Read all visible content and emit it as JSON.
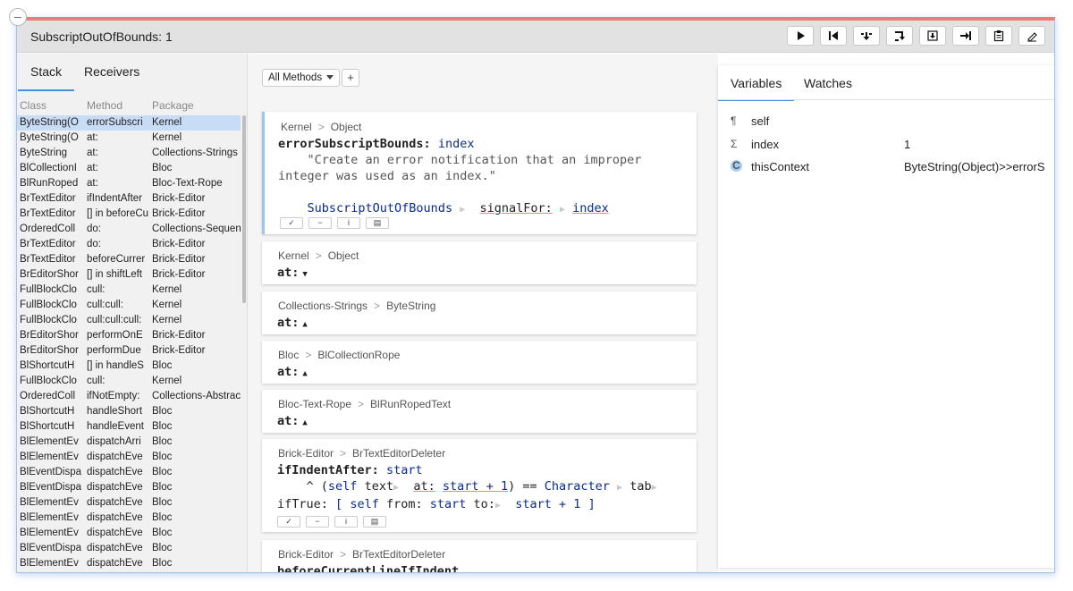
{
  "window": {
    "title": "SubscriptOutOfBounds: 1"
  },
  "toolbar": {
    "buttons": [
      "play-icon",
      "restart-icon",
      "step-into-icon",
      "step-over-icon",
      "step-through-icon",
      "run-to-icon",
      "copy-icon",
      "edit-icon"
    ]
  },
  "stack": {
    "tabs": [
      "Stack",
      "Receivers"
    ],
    "columns": [
      "Class",
      "Method",
      "Package"
    ],
    "rows": [
      [
        "ByteString(O",
        "errorSubscri",
        "Kernel"
      ],
      [
        "ByteString(O",
        "at:",
        "Kernel"
      ],
      [
        "ByteString",
        "at:",
        "Collections-Strings"
      ],
      [
        "BlCollectionI",
        "at:",
        "Bloc"
      ],
      [
        "BlRunRoped",
        "at:",
        "Bloc-Text-Rope"
      ],
      [
        "BrTextEditor",
        "ifIndentAfter",
        "Brick-Editor"
      ],
      [
        "BrTextEditor",
        "[] in beforeCu",
        "Brick-Editor"
      ],
      [
        "OrderedColl",
        "do:",
        "Collections-Sequen"
      ],
      [
        "BrTextEditor",
        "do:",
        "Brick-Editor"
      ],
      [
        "BrTextEditor",
        "beforeCurrer",
        "Brick-Editor"
      ],
      [
        "BrEditorShor",
        "[] in shiftLeft",
        "Brick-Editor"
      ],
      [
        "FullBlockClo",
        "cull:",
        "Kernel"
      ],
      [
        "FullBlockClo",
        "cull:cull:",
        "Kernel"
      ],
      [
        "FullBlockClo",
        "cull:cull:cull:",
        "Kernel"
      ],
      [
        "BrEditorShor",
        "performOnE",
        "Brick-Editor"
      ],
      [
        "BrEditorShor",
        "performDue",
        "Brick-Editor"
      ],
      [
        "BlShortcutH",
        "[] in handleS",
        "Bloc"
      ],
      [
        "FullBlockClo",
        "cull:",
        "Kernel"
      ],
      [
        "OrderedColl",
        "ifNotEmpty:",
        "Collections-Abstract"
      ],
      [
        "BlShortcutH",
        "handleShort",
        "Bloc"
      ],
      [
        "BlShortcutH",
        "handleEvent",
        "Bloc"
      ],
      [
        "BlElementEv",
        "dispatchArri",
        "Bloc"
      ],
      [
        "BlElementEv",
        "dispatchEve",
        "Bloc"
      ],
      [
        "BlEventDispa",
        "dispatchEve",
        "Bloc"
      ],
      [
        "BlEventDispa",
        "dispatchEve",
        "Bloc"
      ],
      [
        "BlElementEv",
        "dispatchEve",
        "Bloc"
      ],
      [
        "BlElementEv",
        "dispatchEve",
        "Bloc"
      ],
      [
        "BlElementEv",
        "dispatchEve",
        "Bloc"
      ],
      [
        "BlEventDispa",
        "dispatchEve",
        "Bloc"
      ],
      [
        "BlElementEv",
        "dispatchEve",
        "Bloc"
      ]
    ]
  },
  "methods": {
    "filter_label": "All Methods",
    "add_label": "+",
    "sep": ">",
    "cards": [
      {
        "package": "Kernel",
        "class": "Object",
        "selector": "errorSubscriptBounds:",
        "arg": "index",
        "comment1": "\"Create an error notification that an improper",
        "comment2": "integer was used as an index.\"",
        "body_class": "SubscriptOutOfBounds",
        "body_msg": "signalFor:",
        "body_arg": "index"
      },
      {
        "package": "Kernel",
        "class": "Object",
        "selector": "at:"
      },
      {
        "package": "Collections-Strings",
        "class": "ByteString",
        "selector": "at:"
      },
      {
        "package": "Bloc",
        "class": "BlCollectionRope",
        "selector": "at:"
      },
      {
        "package": "Bloc-Text-Rope",
        "class": "BlRunRopedText",
        "selector": "at:"
      },
      {
        "package": "Brick-Editor",
        "class": "BrTextEditorDeleter",
        "selector": "ifIndentAfter:",
        "arg": "start",
        "l2_caret": "^",
        "l2_self": "self",
        "l2_text": "text",
        "l2_at": "at:",
        "l2_start": "start + 1",
        "l2_eq": ") == ",
        "l2_char": "Character",
        "l2_tab": "tab",
        "l3_iftrue": "ifTrue:",
        "l3_self": "self",
        "l3_from": "from:",
        "l3_start": "start",
        "l3_to": "to:",
        "l3_plus": "start +",
        "l3_one": "1"
      },
      {
        "package": "Brick-Editor",
        "class": "BrTextEditorDeleter",
        "selector": "beforeCurrentLineIfIndent"
      }
    ],
    "card_buttons": [
      "✓",
      "−",
      "i",
      "clipboard-icon"
    ]
  },
  "variables": {
    "tabs": [
      "Variables",
      "Watches"
    ],
    "rows": [
      {
        "icon": "¶",
        "name": "self",
        "value": ""
      },
      {
        "icon": "Σ",
        "name": "index",
        "value": "1"
      },
      {
        "icon": "C",
        "name": "thisContext",
        "value": "ByteString(Object)>>errorS"
      }
    ]
  }
}
